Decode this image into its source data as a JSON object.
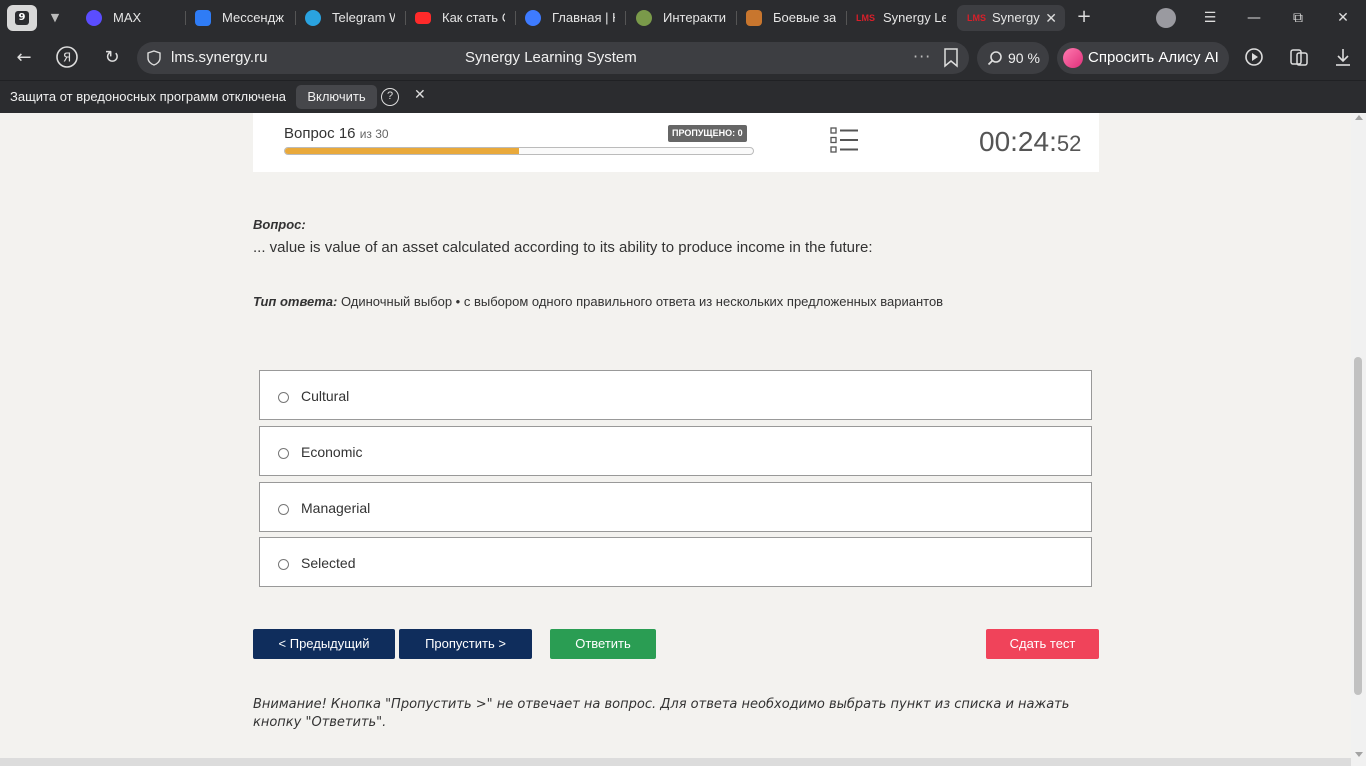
{
  "browser": {
    "tab_counter": "9",
    "tabs": [
      {
        "label": "MAX",
        "icon": "max-icon",
        "color": "#5b4dff"
      },
      {
        "label": "Мессендж",
        "icon": "messenger-icon",
        "color": "#2f7cf6"
      },
      {
        "label": "Telegram W",
        "icon": "telegram-icon",
        "color": "#2aa3e0"
      },
      {
        "label": "Как стать С",
        "icon": "youtube-icon",
        "color": "#ff2a2a"
      },
      {
        "label": "Главная | Н",
        "icon": "site-icon",
        "color": "#3e7bff"
      },
      {
        "label": "Интеракти",
        "icon": "globe-icon",
        "color": "#7a9a4a"
      },
      {
        "label": "Боевые за",
        "icon": "game-icon",
        "color": "#c8762e"
      },
      {
        "label": "Synergy Le",
        "icon": "lms-icon",
        "color": "#d81f2a"
      },
      {
        "label": "Synergy",
        "icon": "lms-icon",
        "color": "#d81f2a"
      }
    ],
    "address": {
      "domain": "lms.synergy.ru",
      "page_title": "Synergy Learning System",
      "more": "···"
    },
    "zoom": "90 %",
    "alice_label": "Спросить Алису AI",
    "infobar": {
      "message": "Защита от вредоносных программ отключена",
      "button": "Включить",
      "help": "?",
      "close": "✕"
    }
  },
  "test": {
    "question_prefix": "Вопрос 16",
    "question_of": "из 30",
    "skipped_badge": "ПРОПУЩЕНО: 0",
    "progress_fraction": 0.5,
    "timer_main": "00:24:",
    "timer_seconds": "52",
    "question_label": "Вопрос:",
    "question_text": "... value is value of an asset calculated according to its ability to produce income in the future:",
    "answer_type_label": "Тип ответа:",
    "answer_type_value": " Одиночный выбор • с выбором одного правильного ответа из нескольких предложенных вариантов",
    "options": [
      "Cultural",
      "Economic",
      "Managerial",
      "Selected"
    ],
    "buttons": {
      "prev": "< Предыдущий",
      "skip": "Пропустить >",
      "answer": "Ответить",
      "submit": "Сдать тест"
    },
    "warning": "Внимание! Кнопка \"Пропустить >\" не отвечает на вопрос. Для ответа необходимо выбрать пункт из списка и нажать кнопку \"Ответить\".",
    "colors": {
      "primary": "#0f2d5c",
      "answer": "#2a9d53",
      "submit": "#f0435a",
      "progress": "#e9a93b"
    }
  }
}
